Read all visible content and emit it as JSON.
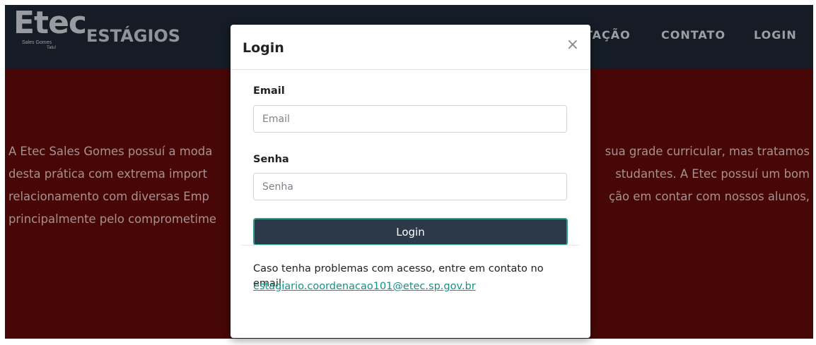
{
  "logo": {
    "brand": "Etec",
    "subtitle_line1": "Sales Gomes",
    "subtitle_line2": "Tatuí",
    "section": "ESTÁGIOS"
  },
  "nav": {
    "items": [
      {
        "label": "TAÇÃO"
      },
      {
        "label": "CONTATO"
      },
      {
        "label": "LOGIN"
      }
    ]
  },
  "main": {
    "paragraph": "A Etec Sales Gomes possuí a moda… sua grade curricular, mas tratamos desta prática com extrema import… studantes. A Etec possuí um bom relacionamento com diversas Emp… ção em contar com nossos alunos, principalmente pelo comprometime…",
    "visible_lines": [
      {
        "left": "A Etec Sales Gomes possuí a moda",
        "right": "sua grade curricular, mas tratamos"
      },
      {
        "left": "desta prática com extrema import",
        "right": "studantes. A Etec possuí um bom"
      },
      {
        "left": "relacionamento com diversas Emp",
        "right": "ção em contar com nossos alunos,"
      },
      {
        "left": "principalmente pelo comprometime",
        "right": ""
      }
    ]
  },
  "modal": {
    "title": "Login",
    "close_symbol": "×",
    "email_label": "Email",
    "email_placeholder": "Email",
    "password_label": "Senha",
    "password_placeholder": "Senha",
    "submit_label": "Login",
    "help_text": "Caso tenha problemas com acesso, entre em contato no email:",
    "help_email": "estagiario.coordenacao101@etec.sp.gov.br"
  },
  "colors": {
    "navbar": "#1b2530",
    "hero_background": "#5a0908",
    "button": "#2b3949",
    "button_border": "#2f9c8d",
    "link": "#1a8f83"
  }
}
